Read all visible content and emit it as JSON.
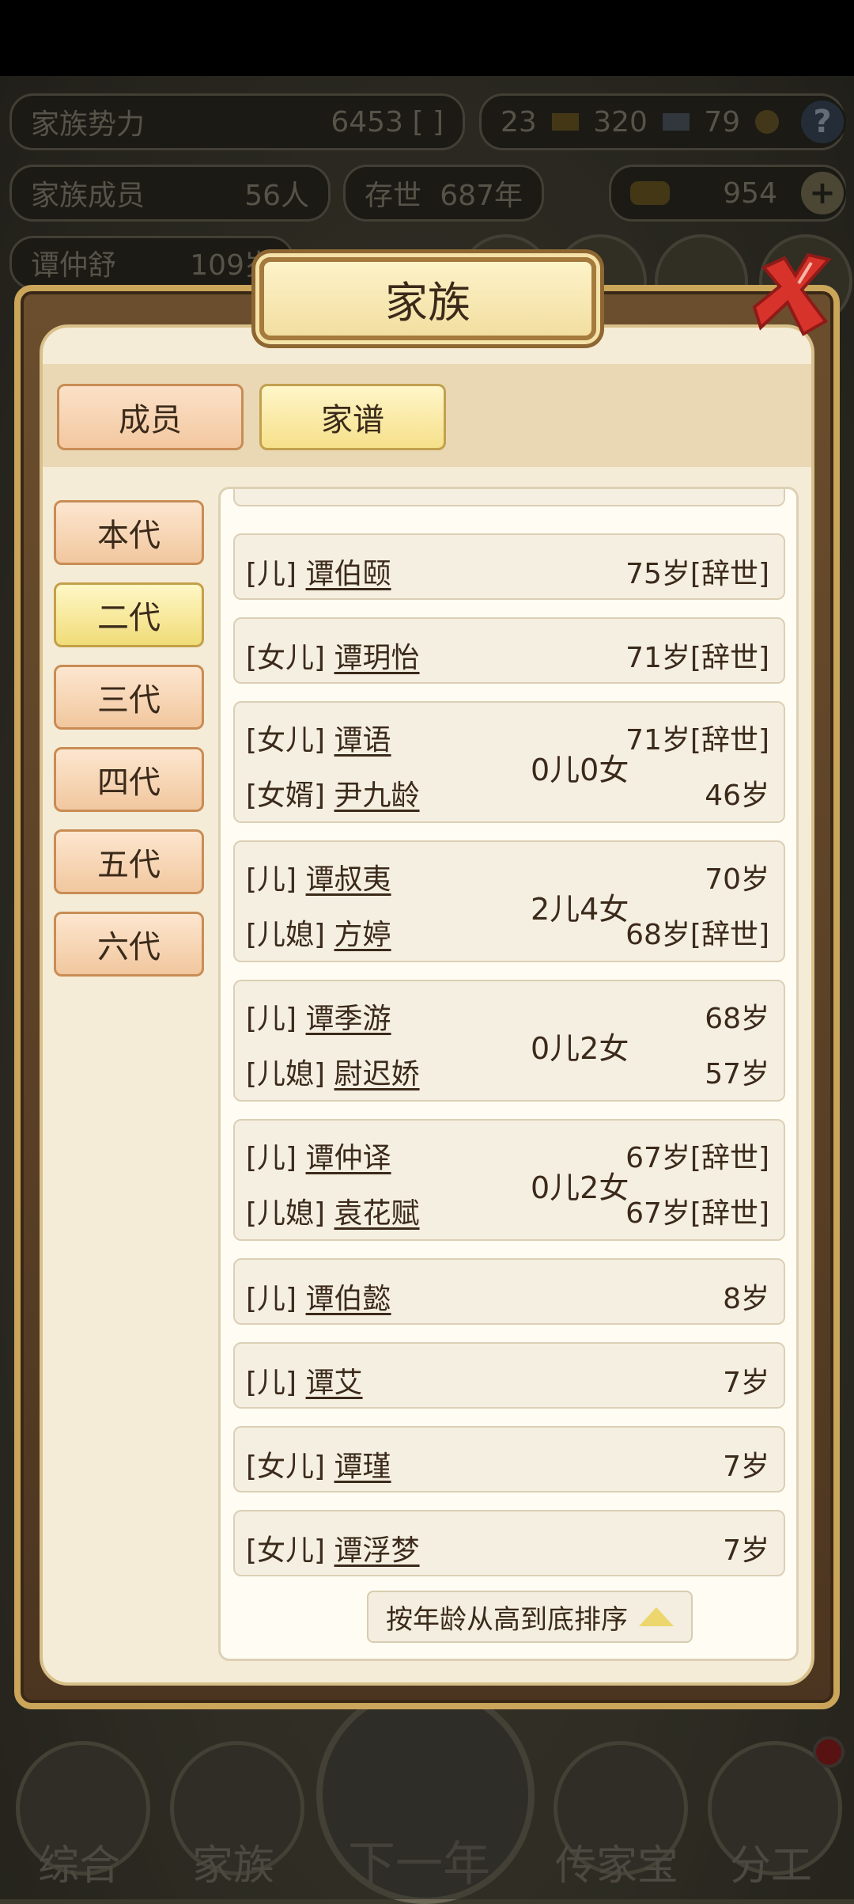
{
  "hud": {
    "clan_power_label": "家族势力",
    "clan_power_value": "6453",
    "clan_rank_bracket": "[ ]",
    "res_a": "23",
    "res_b": "320",
    "res_c": "79",
    "help": "?",
    "members_label": "家族成员",
    "members_value": "56人",
    "exist_label": "存世",
    "exist_value": "687年",
    "gold_value": "954",
    "plus": "+",
    "leader_name": "谭仲舒",
    "leader_age": "109岁"
  },
  "modal": {
    "title": "家族",
    "tabs": [
      {
        "label": "成员",
        "active": false
      },
      {
        "label": "家谱",
        "active": true
      }
    ],
    "generations": [
      {
        "label": "本代",
        "active": false
      },
      {
        "label": "二代",
        "active": true
      },
      {
        "label": "三代",
        "active": false
      },
      {
        "label": "四代",
        "active": false
      },
      {
        "label": "五代",
        "active": false
      },
      {
        "label": "六代",
        "active": false
      }
    ],
    "rows": [
      {
        "role": "[儿]",
        "name": "谭伯颐",
        "age": "75岁[辞世]"
      },
      {
        "role": "[女儿]",
        "name": "谭玥怡",
        "age": "71岁[辞世]"
      },
      {
        "role": "[女儿]",
        "name": "谭语",
        "age": "71岁[辞世]",
        "children": "0儿0女",
        "spouse_role": "[女婿]",
        "spouse_name": "尹九龄",
        "spouse_age": "46岁"
      },
      {
        "role": "[儿]",
        "name": "谭叔夷",
        "age": "70岁",
        "children": "2儿4女",
        "spouse_role": "[儿媳]",
        "spouse_name": "方婷",
        "spouse_age": "68岁[辞世]"
      },
      {
        "role": "[儿]",
        "name": "谭季游",
        "age": "68岁",
        "children": "0儿2女",
        "spouse_role": "[儿媳]",
        "spouse_name": "尉迟娇",
        "spouse_age": "57岁"
      },
      {
        "role": "[儿]",
        "name": "谭仲译",
        "age": "67岁[辞世]",
        "children": "0儿2女",
        "spouse_role": "[儿媳]",
        "spouse_name": "袁花赋",
        "spouse_age": "67岁[辞世]"
      },
      {
        "role": "[儿]",
        "name": "谭伯懿",
        "age": "8岁"
      },
      {
        "role": "[儿]",
        "name": "谭艾",
        "age": "7岁"
      },
      {
        "role": "[女儿]",
        "name": "谭瑾",
        "age": "7岁"
      },
      {
        "role": "[女儿]",
        "name": "谭浮梦",
        "age": "7岁"
      }
    ],
    "sort_label": "按年龄从高到底排序"
  },
  "nav": {
    "items": [
      "综合",
      "家族",
      "下一年",
      "传家宝",
      "分工"
    ]
  },
  "colors": {
    "frame_gold": "#caa55a",
    "panel_cream": "#f4ecd6",
    "active_tab_yellow": "#f0dc78",
    "inactive_tab_peach": "#f1c79e",
    "close_red": "#d8332b"
  }
}
